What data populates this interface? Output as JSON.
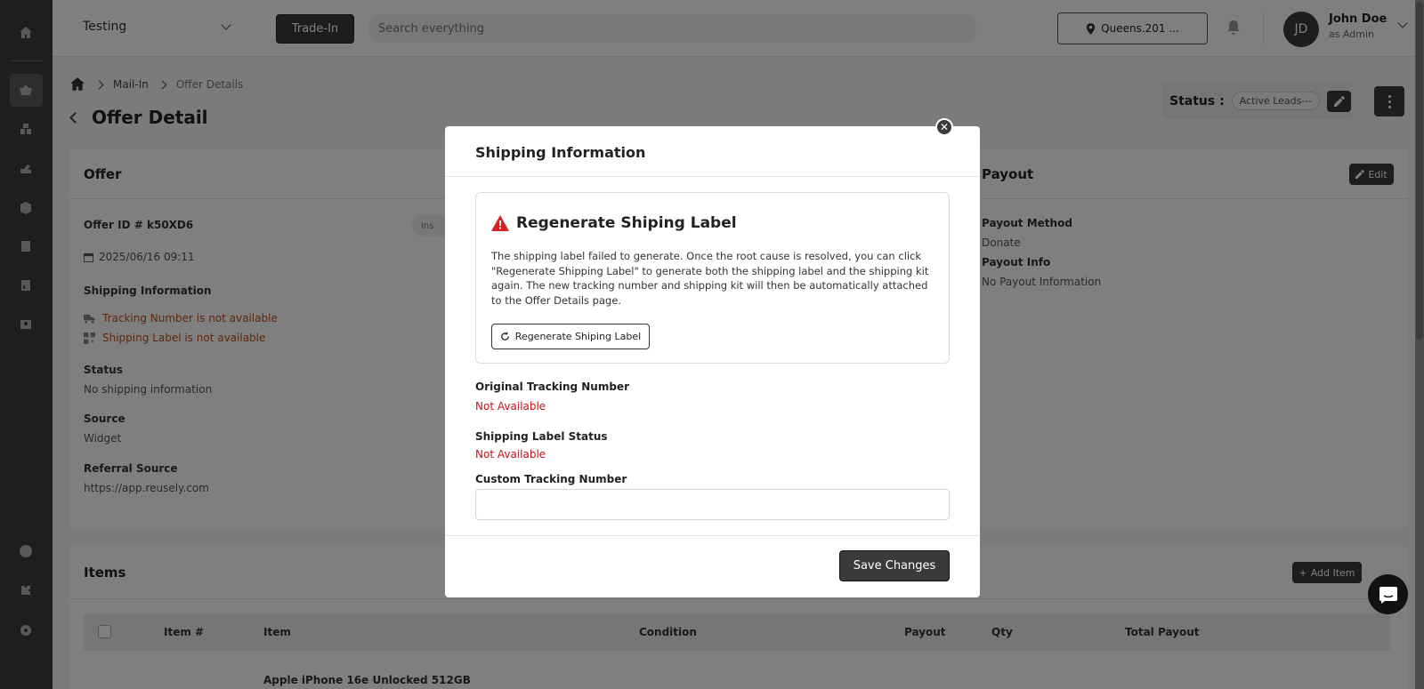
{
  "topbar": {
    "store": "Testing",
    "tradein_label": "Trade-In",
    "search_placeholder": "Search everything",
    "location": "Queens.201 ...",
    "user_initials": "JD",
    "user_name": "John Doe",
    "user_role": "as Admin"
  },
  "breadcrumb": {
    "level1": "Mail-In",
    "level2": "Offer Details"
  },
  "page": {
    "title": "Offer Detail",
    "status_label": "Status :",
    "status_value": "Active Leads---"
  },
  "offer": {
    "heading": "Offer",
    "offer_id": "Offer ID # k50XD6",
    "date": "2025/06/16 09:11",
    "shipping_label": "Shipping Information",
    "tracking_warning": "Tracking Number is not available",
    "label_warning": "Shipping Label is not available",
    "status_label": "Status",
    "status_value": "No shipping information",
    "source_label": "Source",
    "source_value": "Widget",
    "referral_label": "Referral Source",
    "referral_value": "https://app.reusely.com",
    "pill": "ins"
  },
  "payout": {
    "heading": "Payout",
    "edit_label": "Edit",
    "method_label": "Payout Method",
    "method_value": "Donate",
    "info_label": "Payout Info",
    "info_value": "No Payout Information"
  },
  "items": {
    "heading": "Items",
    "add_label": "Add Item",
    "columns": [
      "Item #",
      "Item",
      "Condition",
      "Payout",
      "Qty",
      "Total Payout"
    ],
    "first_item": "Apple iPhone 16e Unlocked 512GB"
  },
  "modal": {
    "title": "Shipping Information",
    "alert_title": "Regenerate Shiping Label",
    "alert_text": "The shipping label failed to generate. Once the root cause is resolved, you can click \"Regenerate Shipping Label\" to generate both the shipping label and the shipping kit again. The new tracking number and shipping kit will then be automatically attached to the Offer Details page.",
    "regen_label": "Regenerate Shiping Label",
    "orig_tracking_label": "Original Tracking Number",
    "orig_tracking_value": "Not Available",
    "label_status_label": "Shipping Label Status",
    "label_status_value": "Not Available",
    "custom_tracking_label": "Custom Tracking Number",
    "custom_tracking_value": "",
    "save_label": "Save Changes"
  },
  "colors": {
    "accent": "#3a3a3a",
    "danger": "#c0121a",
    "warning": "#c0501a"
  }
}
